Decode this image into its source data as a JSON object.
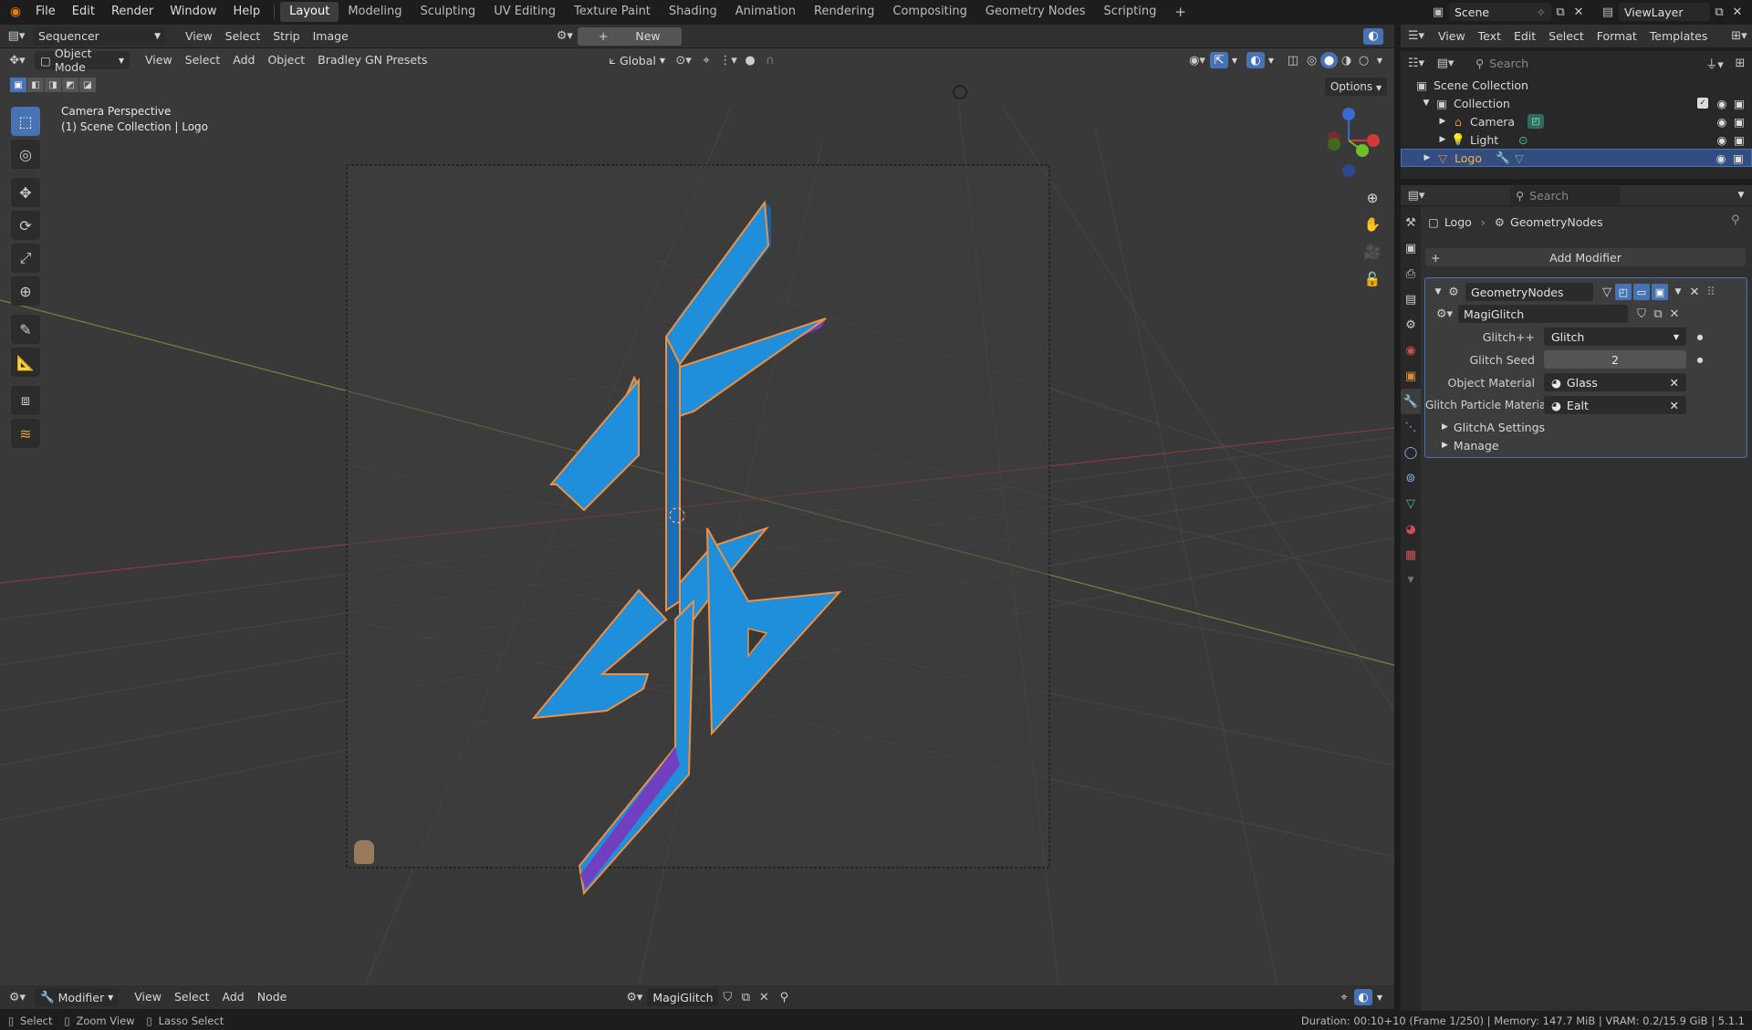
{
  "menu": [
    "File",
    "Edit",
    "Render",
    "Window",
    "Help"
  ],
  "workspaces": [
    "Layout",
    "Modeling",
    "Sculpting",
    "UV Editing",
    "Texture Paint",
    "Shading",
    "Animation",
    "Rendering",
    "Compositing",
    "Geometry Nodes",
    "Scripting"
  ],
  "active_workspace": "Layout",
  "scene": "Scene",
  "view_layer": "ViewLayer",
  "sequencer_header": {
    "editor": "Sequencer",
    "menus": [
      "View",
      "Select",
      "Strip",
      "Image"
    ],
    "new_button": "New"
  },
  "viewport_header": {
    "mode": "Object Mode",
    "menus": [
      "View",
      "Select",
      "Add",
      "Object",
      "Bradley GN Presets"
    ],
    "orientation": "Global",
    "options": "Options"
  },
  "viewport": {
    "camera_label": "Camera Perspective",
    "collection_label": "(1) Scene Collection | Logo"
  },
  "outliner_header": {
    "menus": [
      "View",
      "Text",
      "Edit",
      "Select",
      "Format",
      "Templates"
    ],
    "search_placeholder": "Search"
  },
  "outliner": {
    "root": "Scene Collection",
    "collection": "Collection",
    "items": [
      "Camera",
      "Light",
      "Logo"
    ]
  },
  "properties": {
    "search_placeholder": "Search",
    "breadcrumb": [
      "Logo",
      "GeometryNodes"
    ],
    "add_modifier": "Add Modifier",
    "modifier_name": "GeometryNodes",
    "node_group": "MagiGlitch",
    "fields": [
      {
        "label": "Glitch++",
        "value": "Glitch"
      },
      {
        "label": "Glitch Seed",
        "value": "2"
      },
      {
        "label": "Object Material",
        "value": "Glass"
      },
      {
        "label": "Glitch Particle Material",
        "value": "Ealt"
      }
    ],
    "panels": [
      "GlitchA Settings",
      "Manage"
    ]
  },
  "node_header": {
    "editor": "Modifier",
    "menus": [
      "View",
      "Select",
      "Add",
      "Node"
    ],
    "node_group": "MagiGlitch"
  },
  "statusbar": {
    "select": "Select",
    "zoom": "Zoom View",
    "lasso": "Lasso Select",
    "info": "Duration: 00:10+10 (Frame 1/250) | Memory: 147.7 MiB | VRAM: 0.2/15.9 GiB | 5.1.1"
  },
  "colors": {
    "accent": "#4772b3",
    "logo_fill": "#1f8fdb",
    "logo_outline": "#f09040",
    "selected_row": "#334d80"
  }
}
